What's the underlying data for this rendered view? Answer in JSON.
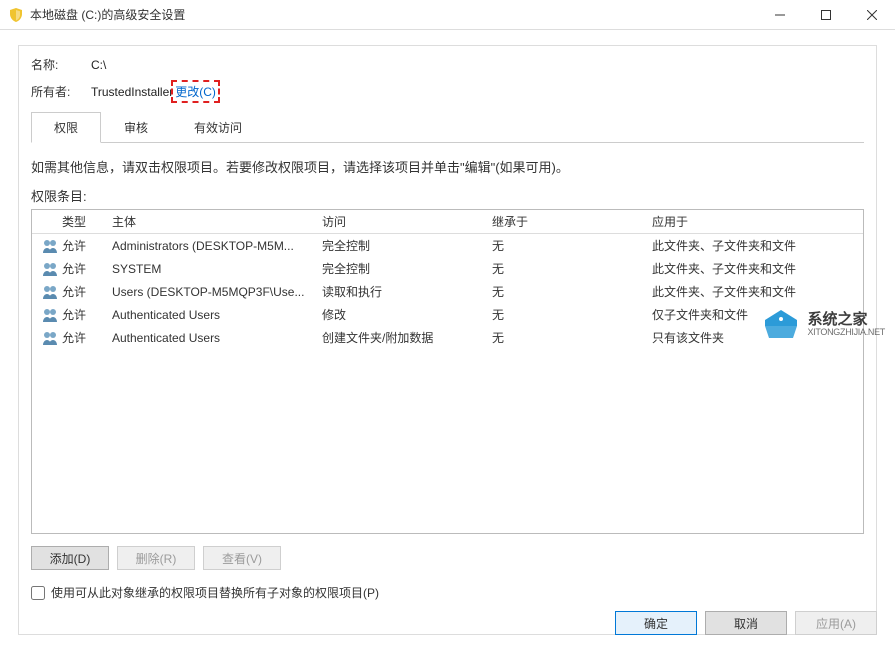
{
  "titlebar": {
    "title": "本地磁盘 (C:)的高级安全设置"
  },
  "meta": {
    "name_label": "名称:",
    "name_value": "C:\\",
    "owner_label": "所有者:",
    "owner_value": "TrustedInstaller",
    "change_link": "更改(C)"
  },
  "tabs": {
    "permissions": "权限",
    "auditing": "审核",
    "effective": "有效访问"
  },
  "info_text": "如需其他信息，请双击权限项目。若要修改权限项目，请选择该项目并单击\"编辑\"(如果可用)。",
  "section_label": "权限条目:",
  "columns": {
    "type": "类型",
    "principal": "主体",
    "access": "访问",
    "inherited_from": "继承于",
    "applies_to": "应用于"
  },
  "entries": [
    {
      "type": "允许",
      "principal": "Administrators (DESKTOP-M5M...",
      "access": "完全控制",
      "inherited_from": "无",
      "applies_to": "此文件夹、子文件夹和文件"
    },
    {
      "type": "允许",
      "principal": "SYSTEM",
      "access": "完全控制",
      "inherited_from": "无",
      "applies_to": "此文件夹、子文件夹和文件"
    },
    {
      "type": "允许",
      "principal": "Users (DESKTOP-M5MQP3F\\Use...",
      "access": "读取和执行",
      "inherited_from": "无",
      "applies_to": "此文件夹、子文件夹和文件"
    },
    {
      "type": "允许",
      "principal": "Authenticated Users",
      "access": "修改",
      "inherited_from": "无",
      "applies_to": "仅子文件夹和文件"
    },
    {
      "type": "允许",
      "principal": "Authenticated Users",
      "access": "创建文件夹/附加数据",
      "inherited_from": "无",
      "applies_to": "只有该文件夹"
    }
  ],
  "buttons": {
    "add": "添加(D)",
    "remove": "删除(R)",
    "view": "查看(V)"
  },
  "checkbox_label": "使用可从此对象继承的权限项目替换所有子对象的权限项目(P)",
  "footer": {
    "ok": "确定",
    "cancel": "取消",
    "apply": "应用(A)"
  },
  "watermark": {
    "cn": "系统之家",
    "en": "XITONGZHIJIA.NET"
  }
}
